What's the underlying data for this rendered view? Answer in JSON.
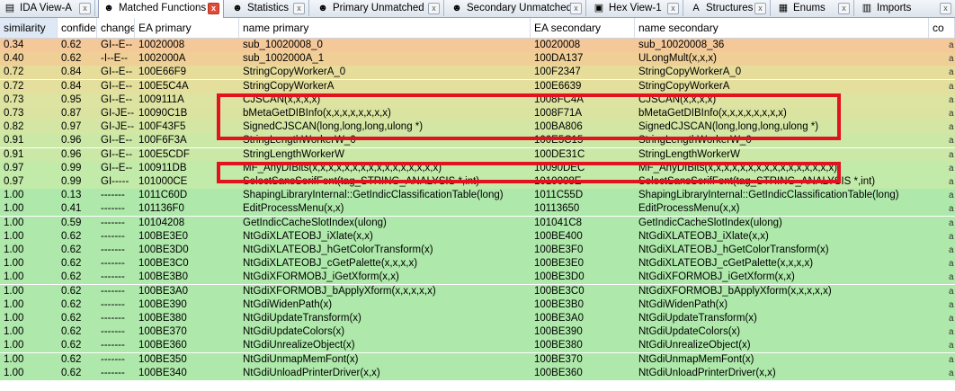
{
  "tabs": [
    {
      "label": "IDA View-A",
      "icon": "ida-view-icon",
      "glyph": "▤"
    },
    {
      "label": "Matched Functions",
      "icon": "bindiff-face-icon",
      "glyph": "☻"
    },
    {
      "label": "Statistics",
      "icon": "bindiff-face-icon",
      "glyph": "☻"
    },
    {
      "label": "Primary Unmatched",
      "icon": "bindiff-face-icon",
      "glyph": "☻"
    },
    {
      "label": "Secondary Unmatched",
      "icon": "bindiff-face-icon",
      "glyph": "☻"
    },
    {
      "label": "Hex View-1",
      "icon": "hex-view-icon",
      "glyph": "▣"
    },
    {
      "label": "Structures",
      "icon": "structures-icon",
      "glyph": "A"
    },
    {
      "label": "Enums",
      "icon": "enums-icon",
      "glyph": "▦"
    },
    {
      "label": "Imports",
      "icon": "imports-icon",
      "glyph": "▥"
    }
  ],
  "close_glyph": "x",
  "columns": [
    "similarity",
    "confide",
    "change",
    "EA primary",
    "name primary",
    "EA secondary",
    "name secondary",
    "co"
  ],
  "rows": [
    [
      "0.34",
      "0.62",
      "GI--E--",
      "10020008",
      "sub_10020008_0",
      "10020008",
      "sub_10020008_36"
    ],
    [
      "0.40",
      "0.62",
      "-I--E--",
      "1002000A",
      "sub_1002000A_1",
      "100DA137",
      "ULongMult(x,x,x)"
    ],
    [
      "0.72",
      "0.84",
      "GI--E--",
      "100E66F9",
      "StringCopyWorkerA_0",
      "100F2347",
      "StringCopyWorkerA_0"
    ],
    [
      "0.72",
      "0.84",
      "GI--E--",
      "100E5C4A",
      "StringCopyWorkerA",
      "100E6639",
      "StringCopyWorkerA"
    ],
    [
      "0.73",
      "0.95",
      "GI--E--",
      "1009111A",
      "CJSCAN(x,x,x,x)",
      "1008FC4A",
      "CJSCAN(x,x,x,x)"
    ],
    [
      "0.73",
      "0.87",
      "GI-JE--",
      "10090C1B",
      "bMetaGetDIBInfo(x,x,x,x,x,x,x,x)",
      "1008F71A",
      "bMetaGetDIBInfo(x,x,x,x,x,x,x,x)"
    ],
    [
      "0.82",
      "0.97",
      "GI-JE--",
      "100F43F5",
      "SignedCJSCAN(long,long,long,ulong *)",
      "100BA806",
      "SignedCJSCAN(long,long,long,ulong *)"
    ],
    [
      "0.91",
      "0.96",
      "GI--E--",
      "100F6F3A",
      "StringLengthWorkerW_0",
      "100E5C15",
      "StringLengthWorkerW_0"
    ],
    [
      "0.91",
      "0.96",
      "GI--E--",
      "100E5CDF",
      "StringLengthWorkerW",
      "100DE31C",
      "StringLengthWorkerW"
    ],
    [
      "0.97",
      "0.99",
      "GI--E--",
      "100911DB",
      "MF_AnyDIBits(x,x,x,x,x,x,x,x,x,x,x,x,x,x,x,x)",
      "10090DEC",
      "MF_AnyDIBits(x,x,x,x,x,x,x,x,x,x,x,x,x,x,x,x)"
    ],
    [
      "0.97",
      "0.99",
      "GI-----",
      "101000CE",
      "SelectSansSerifFont(tag_STRING_ANALYSIS *,int)",
      "1010008E",
      "SelectSansSerifFont(tag_STRING_ANALYSIS *,int)"
    ],
    [
      "1.00",
      "0.13",
      "-------",
      "1011C60D",
      "ShapingLibraryInternal::GetIndicClassificationTable(long)",
      "1011C55D",
      "ShapingLibraryInternal::GetIndicClassificationTable(long)"
    ],
    [
      "1.00",
      "0.41",
      "-------",
      "101136F0",
      "EditProcessMenu(x,x)",
      "10113650",
      "EditProcessMenu(x,x)"
    ],
    [
      "1.00",
      "0.59",
      "-------",
      "10104208",
      "GetIndicCacheSlotIndex(ulong)",
      "101041C8",
      "GetIndicCacheSlotIndex(ulong)"
    ],
    [
      "1.00",
      "0.62",
      "-------",
      "100BE3E0",
      "NtGdiXLATEOBJ_iXlate(x,x)",
      "100BE400",
      "NtGdiXLATEOBJ_iXlate(x,x)"
    ],
    [
      "1.00",
      "0.62",
      "-------",
      "100BE3D0",
      "NtGdiXLATEOBJ_hGetColorTransform(x)",
      "100BE3F0",
      "NtGdiXLATEOBJ_hGetColorTransform(x)"
    ],
    [
      "1.00",
      "0.62",
      "-------",
      "100BE3C0",
      "NtGdiXLATEOBJ_cGetPalette(x,x,x,x)",
      "100BE3E0",
      "NtGdiXLATEOBJ_cGetPalette(x,x,x,x)"
    ],
    [
      "1.00",
      "0.62",
      "-------",
      "100BE3B0",
      "NtGdiXFORMOBJ_iGetXform(x,x)",
      "100BE3D0",
      "NtGdiXFORMOBJ_iGetXform(x,x)"
    ],
    [
      "1.00",
      "0.62",
      "-------",
      "100BE3A0",
      "NtGdiXFORMOBJ_bApplyXform(x,x,x,x,x)",
      "100BE3C0",
      "NtGdiXFORMOBJ_bApplyXform(x,x,x,x,x)"
    ],
    [
      "1.00",
      "0.62",
      "-------",
      "100BE390",
      "NtGdiWidenPath(x)",
      "100BE3B0",
      "NtGdiWidenPath(x)"
    ],
    [
      "1.00",
      "0.62",
      "-------",
      "100BE380",
      "NtGdiUpdateTransform(x)",
      "100BE3A0",
      "NtGdiUpdateTransform(x)"
    ],
    [
      "1.00",
      "0.62",
      "-------",
      "100BE370",
      "NtGdiUpdateColors(x)",
      "100BE390",
      "NtGdiUpdateColors(x)"
    ],
    [
      "1.00",
      "0.62",
      "-------",
      "100BE360",
      "NtGdiUnrealizeObject(x)",
      "100BE380",
      "NtGdiUnrealizeObject(x)"
    ],
    [
      "1.00",
      "0.62",
      "-------",
      "100BE350",
      "NtGdiUnmapMemFont(x)",
      "100BE370",
      "NtGdiUnmapMemFont(x)"
    ],
    [
      "1.00",
      "0.62",
      "-------",
      "100BE340",
      "NtGdiUnloadPrinterDriver(x,x)",
      "100BE360",
      "NtGdiUnloadPrinterDriver(x,x)"
    ]
  ],
  "row_colors": [
    "#f5c89a",
    "#f0cf97",
    "#e6dd9b",
    "#e4df9c",
    "#dde3a0",
    "#dbe3a1",
    "#d3e6a4",
    "#cbe8a6",
    "#cbe8a6",
    "#c2eaa9",
    "#c2eaa9",
    "#aee8aa",
    "#aee8aa",
    "#aee8aa",
    "#aee8aa",
    "#aee8aa",
    "#aee8aa",
    "#aee8aa",
    "#aee8aa",
    "#aee8aa",
    "#aee8aa",
    "#aee8aa",
    "#aee8aa",
    "#aee8aa",
    "#aee8aa"
  ],
  "highlight_color": "#e2121f",
  "last_column_marks": [
    "a",
    "a",
    "a",
    "a",
    "a",
    "a",
    "a",
    "a",
    "a",
    "a",
    "a",
    "a",
    "a",
    "a",
    "a",
    "a",
    "a",
    "a",
    "a",
    "a",
    "a",
    "a",
    "a",
    "a",
    "a"
  ]
}
